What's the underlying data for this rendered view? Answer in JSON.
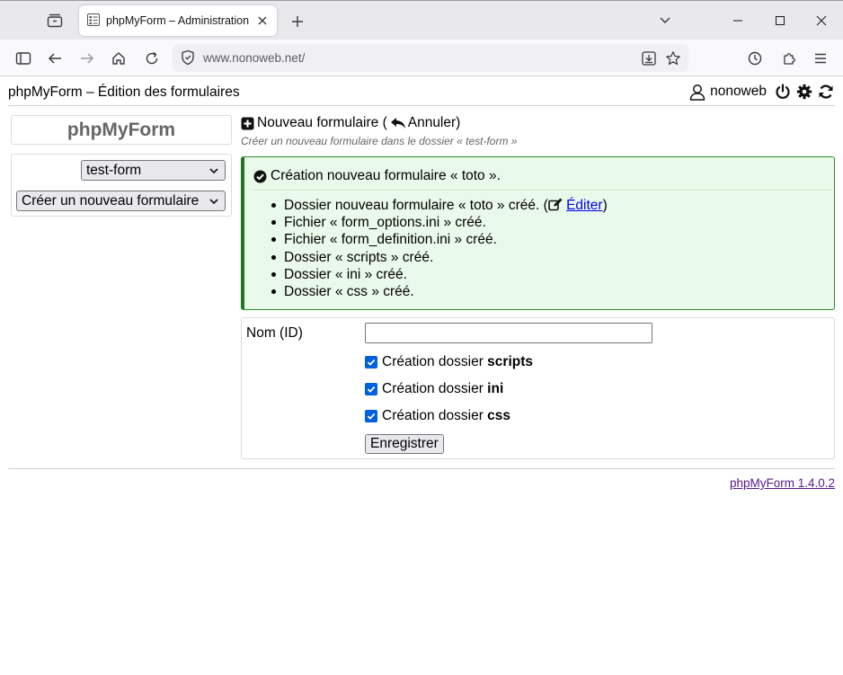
{
  "browser": {
    "tab_title": "phpMyForm – Administration",
    "url": "www.nonoweb.net/"
  },
  "header": {
    "title": "phpMyForm – Édition des formulaires",
    "username": "nonoweb"
  },
  "sidebar": {
    "brand": "phpMyForm",
    "form_select": "test-form",
    "action_select": "Créer un nouveau formulaire"
  },
  "main": {
    "section_title": "Nouveau formulaire (",
    "cancel_label": "Annuler",
    "section_title_end": ")",
    "section_subtitle": "Créer un nouveau formulaire dans le dossier « test-form »",
    "success": {
      "heading": "Création nouveau formulaire « toto ».",
      "items": [
        "Dossier nouveau formulaire « toto » créé. (",
        "Fichier « form_options.ini » créé.",
        "Fichier « form_definition.ini » créé.",
        "Dossier « scripts » créé.",
        "Dossier « ini » créé.",
        "Dossier « css » créé."
      ],
      "edit_link": "Éditer",
      "edit_suffix": ")"
    },
    "form": {
      "name_label": "Nom (ID)",
      "name_value": "",
      "checkbox_prefix": "Création dossier ",
      "checkboxes": [
        "scripts",
        "ini",
        "css"
      ],
      "submit_label": "Enregistrer"
    }
  },
  "footer": {
    "version_link": "phpMyForm 1.4.0.2"
  },
  "colors": {
    "success_bg": "#eafaea",
    "success_border": "#1d7a1d",
    "checkbox": "#0060df",
    "link": "#0000ee",
    "visited_link": "#551a8b"
  }
}
